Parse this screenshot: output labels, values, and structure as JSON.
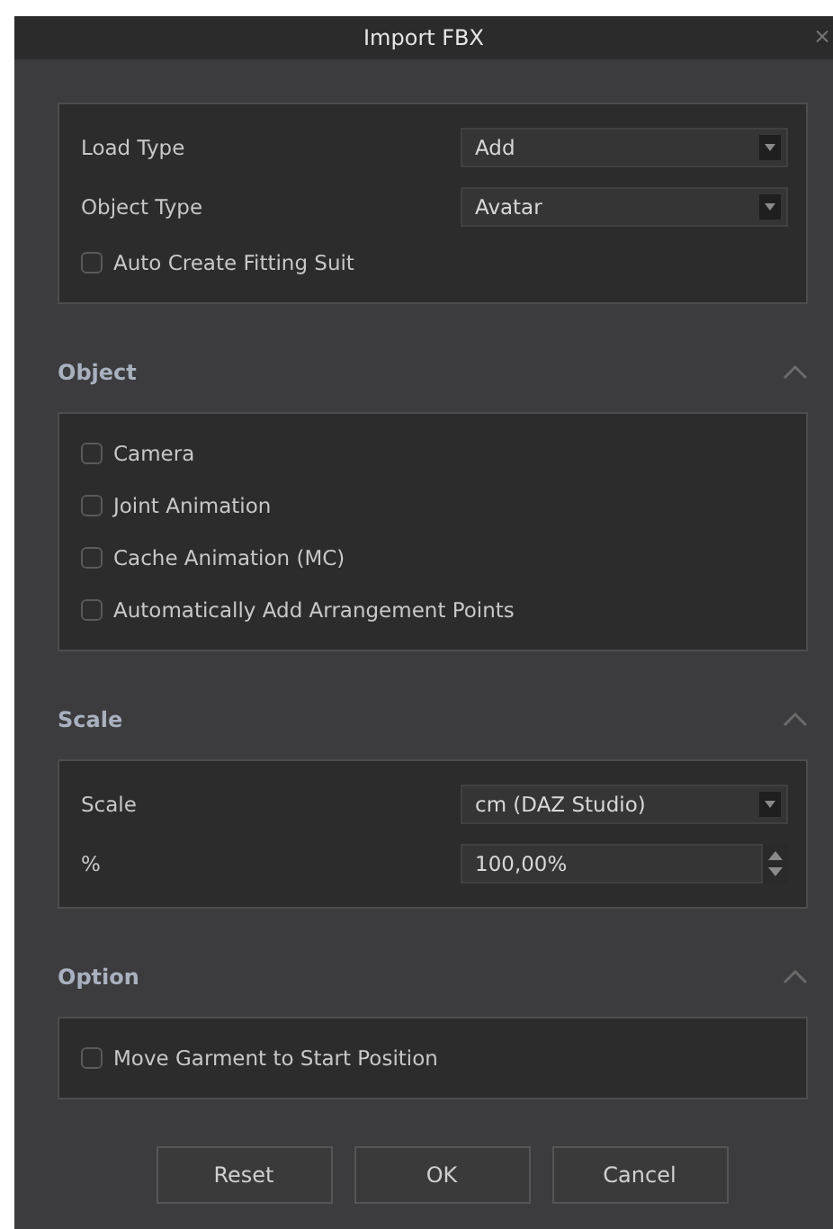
{
  "window": {
    "title": "Import FBX",
    "close": "×"
  },
  "sections": [
    {
      "rows": [
        {
          "kind": "dropdown",
          "label": "Load Type",
          "value": "Add"
        },
        {
          "kind": "dropdown",
          "label": "Object Type",
          "value": "Avatar"
        },
        {
          "kind": "checkbox",
          "label": "Auto Create Fitting Suit",
          "checked": false
        }
      ]
    },
    {
      "title": "Object",
      "expanded": true,
      "rows": [
        {
          "kind": "checkbox",
          "label": "Camera",
          "checked": false
        },
        {
          "kind": "checkbox",
          "label": "Joint Animation",
          "checked": false
        },
        {
          "kind": "checkbox",
          "label": "Cache Animation (MC)",
          "checked": false
        },
        {
          "kind": "checkbox",
          "label": "Automatically Add Arrangement Points",
          "checked": false
        }
      ]
    },
    {
      "title": "Scale",
      "expanded": true,
      "rows": [
        {
          "kind": "dropdown",
          "label": "Scale",
          "value": "cm (DAZ Studio)"
        },
        {
          "kind": "spinbox",
          "label": "%",
          "value": "100,00%"
        }
      ]
    },
    {
      "title": "Option",
      "expanded": true,
      "rows": [
        {
          "kind": "checkbox",
          "label": "Move Garment to Start Position",
          "checked": false
        }
      ]
    }
  ],
  "buttons": [
    "Reset",
    "OK",
    "Cancel"
  ]
}
